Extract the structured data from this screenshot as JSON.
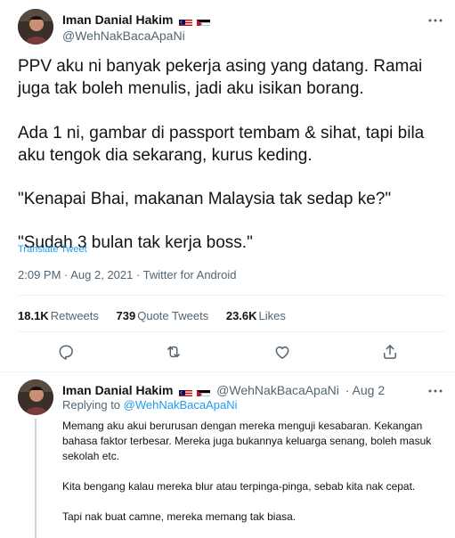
{
  "tweet": {
    "author_name": "Iman Danial Hakim",
    "author_handle": "@WehNakBacaApaNi",
    "more_icon": "more-horizontal-icon",
    "paragraphs": [
      "PPV aku ni banyak pekerja asing yang datang. Ramai juga tak boleh menulis, jadi aku isikan borang.",
      "Ada 1 ni, gambar di passport tembam & sihat, tapi bila aku tengok dia sekarang, kurus keding.",
      "\"Kenapai Bhai, makanan Malaysia tak sedap ke?\"",
      "\"Sudah 3 bulan tak kerja boss.\""
    ],
    "translate_label": "Translate Tweet",
    "meta": "2:09 PM · Aug 2, 2021 · Twitter for Android",
    "stats": {
      "retweets_count": "18.1K",
      "retweets_label": "Retweets",
      "quotes_count": "739",
      "quotes_label": "Quote Tweets",
      "likes_count": "23.6K",
      "likes_label": "Likes"
    },
    "actions": [
      "reply-icon",
      "retweet-icon",
      "like-icon",
      "share-icon"
    ]
  },
  "reply": {
    "author_name": "Iman Danial Hakim",
    "author_handle": "@WehNakBacaApaNi",
    "date": "· Aug 2",
    "replying_prefix": "Replying to",
    "replying_handle": "@WehNakBacaApaNi",
    "paragraphs": [
      "Memang aku akui berurusan dengan mereka menguji kesabaran. Kekangan bahasa faktor terbesar. Mereka juga bukannya keluarga senang, boleh masuk sekolah etc.",
      "Kita bengang kalau mereka blur atau terpinga-pinga, sebab kita nak cepat.",
      "Tapi nak buat camne, mereka memang tak biasa."
    ]
  },
  "colors": {
    "text": "#0f1419",
    "secondary": "#536471",
    "link": "#1d9bf0",
    "divider": "#eff3f4"
  }
}
